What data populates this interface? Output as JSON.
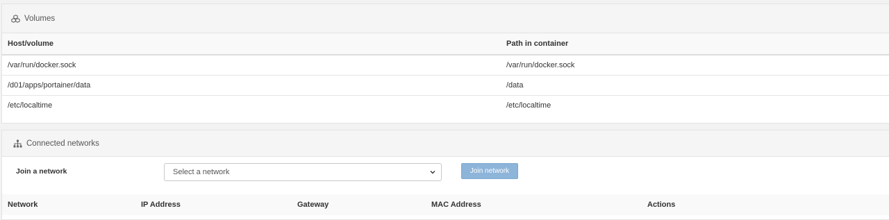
{
  "volumes": {
    "heading": "Volumes",
    "icon": "cubes-icon",
    "columns": [
      "Host/volume",
      "Path in container"
    ],
    "rows": [
      [
        "/var/run/docker.sock",
        "/var/run/docker.sock"
      ],
      [
        "/d01/apps/portainer/data",
        "/data"
      ],
      [
        "/etc/localtime",
        "/etc/localtime"
      ]
    ]
  },
  "networks": {
    "heading": "Connected networks",
    "icon": "sitemap-icon",
    "join_label": "Join a network",
    "select_placeholder": "Select a network",
    "join_button": "Join network",
    "join_button_color": "#8db4d9",
    "columns": [
      "Network",
      "IP Address",
      "Gateway",
      "MAC Address",
      "Actions"
    ]
  }
}
